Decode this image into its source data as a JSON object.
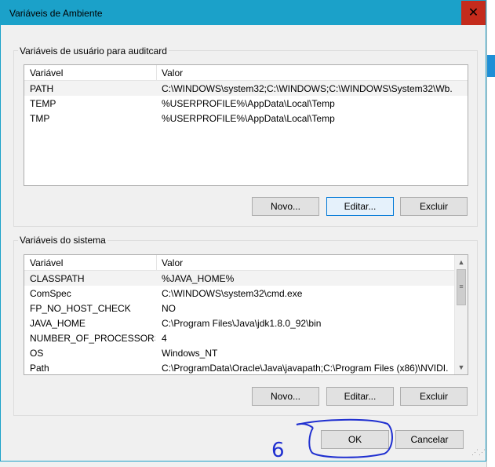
{
  "dialog": {
    "title": "Variáveis de Ambiente",
    "close_glyph": "✕"
  },
  "user_section": {
    "title": "Variáveis de usuário para auditcard",
    "columns": [
      "Variável",
      "Valor"
    ],
    "rows": [
      {
        "name": "PATH",
        "value": "C:\\WINDOWS\\system32;C:\\WINDOWS;C:\\WINDOWS\\System32\\Wb..."
      },
      {
        "name": "TEMP",
        "value": "%USERPROFILE%\\AppData\\Local\\Temp"
      },
      {
        "name": "TMP",
        "value": "%USERPROFILE%\\AppData\\Local\\Temp"
      }
    ],
    "buttons": {
      "new": "Novo...",
      "edit": "Editar...",
      "delete": "Excluir"
    }
  },
  "system_section": {
    "title": "Variáveis do sistema",
    "columns": [
      "Variável",
      "Valor"
    ],
    "rows": [
      {
        "name": "CLASSPATH",
        "value": "%JAVA_HOME%"
      },
      {
        "name": "ComSpec",
        "value": "C:\\WINDOWS\\system32\\cmd.exe"
      },
      {
        "name": "FP_NO_HOST_CHECK",
        "value": "NO"
      },
      {
        "name": "JAVA_HOME",
        "value": "C:\\Program Files\\Java\\jdk1.8.0_92\\bin"
      },
      {
        "name": "NUMBER_OF_PROCESSORS",
        "value": "4"
      },
      {
        "name": "OS",
        "value": "Windows_NT"
      },
      {
        "name": "Path",
        "value": "C:\\ProgramData\\Oracle\\Java\\javapath;C:\\Program Files (x86)\\NVIDI..."
      }
    ],
    "buttons": {
      "new": "Novo...",
      "edit": "Editar...",
      "delete": "Excluir"
    }
  },
  "footer": {
    "ok": "OK",
    "cancel": "Cancelar"
  },
  "colors": {
    "titlebar": "#1ba1c9",
    "close": "#c42b1c",
    "annotation": "#1f2fd0"
  },
  "annotation": {
    "handwritten": "6"
  }
}
